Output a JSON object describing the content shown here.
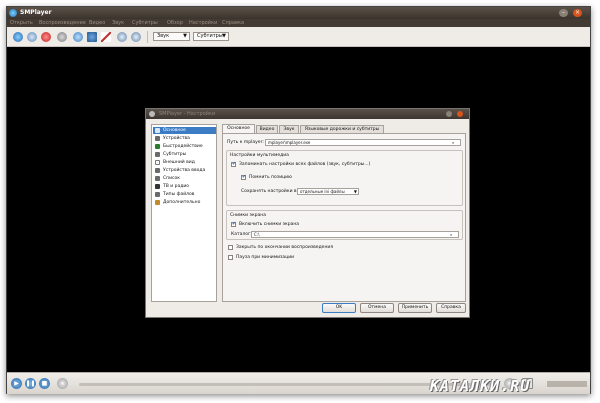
{
  "app": {
    "title": "SMPlayer"
  },
  "menu": [
    "Открыть",
    "Воспроизведение",
    "Видео",
    "Звук",
    "Субтитры",
    "Обзор",
    "Настройки",
    "Справка"
  ],
  "toolbar": {
    "audio_label": "Звук",
    "subs_label": "Субтитры"
  },
  "dialog": {
    "title": "SMPlayer - Настройки",
    "categories": [
      "Основное",
      "Устройства",
      "Быстродействие",
      "Субтитры",
      "Внешний вид",
      "Устройства ввода",
      "Список",
      "ТВ и радио",
      "Типы файлов",
      "Дополнительно"
    ],
    "selected_category": "Основное",
    "tabs": [
      "Основное",
      "Видео",
      "Звук",
      "Языковые дорожки и субтитры"
    ],
    "mplayer_label": "Путь к mplayer:",
    "mplayer_value": "mplayer\\mplayer.exe",
    "media_group_title": "Настройки мультимедиа",
    "remember_settings_label": "Запоминать настройки всех файлов (звук, субтитры...)",
    "remember_position_label": "Помнить позицию",
    "save_settings_label": "Сохранять настройки в",
    "save_settings_value": "отдельные ini файлы",
    "screenshots_group_title": "Снимки экрана",
    "enable_screenshots_label": "Включить снимки экрана",
    "folder_label": "Каталог:",
    "folder_value": "C:\\",
    "close_on_finish_label": "Закрыть по окончании воспроизведения",
    "pause_minimize_label": "Пауза при минимизации",
    "buttons": {
      "ok": "OK",
      "cancel": "Отмена",
      "apply": "Применить",
      "help": "Справка"
    }
  },
  "watermark": "КАТАЛКИ.RU",
  "colors": {
    "accent": "#3b7cc4",
    "titlebar": "#3a332c",
    "close": "#d9541c"
  }
}
